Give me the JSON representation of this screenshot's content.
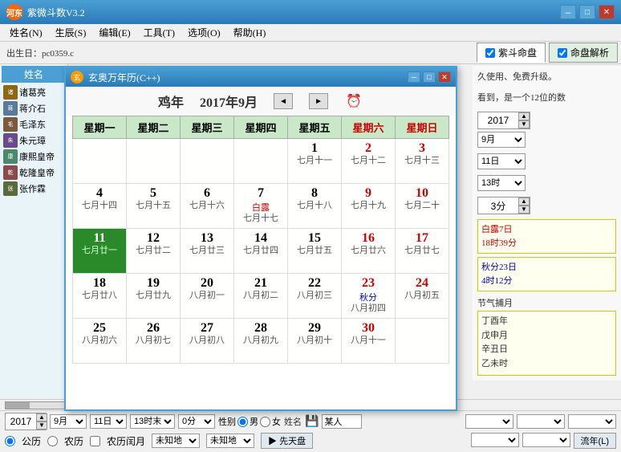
{
  "app": {
    "title": "紫微斗数V3.2",
    "logo": "河东",
    "menu": {
      "items": [
        "姓名(N)",
        "生辰(S)",
        "编辑(E)",
        "工具(T)",
        "选项(O)",
        "帮助(H)"
      ]
    },
    "toolbar": {
      "date_label": "出生日：pc0359,c",
      "tabs": [
        {
          "label": "紫斗命盘",
          "checked": true
        },
        {
          "label": "命盘解析",
          "checked": true
        }
      ]
    }
  },
  "sidebar": {
    "header": "姓名",
    "people": [
      {
        "name": "诸葛亮",
        "has_avatar": true
      },
      {
        "name": "蒋介石",
        "has_avatar": true
      },
      {
        "name": "毛泽东",
        "has_avatar": true
      },
      {
        "name": "朱元璋",
        "has_avatar": true
      },
      {
        "name": "康熙皇帝",
        "has_avatar": true
      },
      {
        "name": "乾隆皇帝",
        "has_avatar": true
      },
      {
        "name": "张作霖",
        "has_avatar": true
      }
    ]
  },
  "calendar": {
    "title": "玄奥万年历(C++)",
    "year_label": "鸡年",
    "month_label": "2017年9月",
    "weekdays": [
      "星期一",
      "星期二",
      "星期三",
      "星期四",
      "星期五",
      "星期六",
      "星期日"
    ],
    "weeks": [
      [
        {
          "day": "",
          "lunar": ""
        },
        {
          "day": "",
          "lunar": ""
        },
        {
          "day": "",
          "lunar": ""
        },
        {
          "day": "",
          "lunar": ""
        },
        {
          "day": "1",
          "lunar": "七月十一",
          "red": false
        },
        {
          "day": "2",
          "lunar": "七月十二",
          "red": true,
          "weekend": true
        },
        {
          "day": "3",
          "lunar": "七月十三",
          "red": true,
          "weekend": true
        }
      ],
      [
        {
          "day": "4",
          "lunar": "七月十四"
        },
        {
          "day": "5",
          "lunar": "七月十五"
        },
        {
          "day": "6",
          "lunar": "七月十六"
        },
        {
          "day": "7",
          "lunar": "七月十七",
          "solar_term": "白露",
          "term_color": "red"
        },
        {
          "day": "8",
          "lunar": "七月十八"
        },
        {
          "day": "9",
          "lunar": "七月十九",
          "weekend": true
        },
        {
          "day": "10",
          "lunar": "七月二十",
          "weekend": true
        }
      ],
      [
        {
          "day": "11",
          "lunar": "七月廿一",
          "today": true
        },
        {
          "day": "12",
          "lunar": "七月廿二"
        },
        {
          "day": "13",
          "lunar": "七月廿三"
        },
        {
          "day": "14",
          "lunar": "七月廿四"
        },
        {
          "day": "15",
          "lunar": "七月廿五"
        },
        {
          "day": "16",
          "lunar": "七月廿六",
          "weekend": true
        },
        {
          "day": "17",
          "lunar": "七月廿七",
          "weekend": true
        }
      ],
      [
        {
          "day": "18",
          "lunar": "七月廿八"
        },
        {
          "day": "19",
          "lunar": "七月廿九"
        },
        {
          "day": "20",
          "lunar": "八月初一"
        },
        {
          "day": "21",
          "lunar": "八月初二"
        },
        {
          "day": "22",
          "lunar": "八月初三"
        },
        {
          "day": "23",
          "lunar": "八月初四",
          "solar_term": "秋分",
          "term_color": "blue",
          "weekend": true
        },
        {
          "day": "24",
          "lunar": "八月初五",
          "weekend": true
        }
      ],
      [
        {
          "day": "25",
          "lunar": "八月初六"
        },
        {
          "day": "26",
          "lunar": "八月初七"
        },
        {
          "day": "27",
          "lunar": "八月初八"
        },
        {
          "day": "28",
          "lunar": "八月初九"
        },
        {
          "day": "29",
          "lunar": "八月初十"
        },
        {
          "day": "30",
          "lunar": "八月十一",
          "weekend": true
        },
        {
          "day": "",
          "lunar": "",
          "weekend": true
        }
      ]
    ]
  },
  "right_panel": {
    "description": "久使用、免费升级。",
    "description2": "看到，是一个12位的数",
    "year": "2017",
    "month": "9月",
    "day": "11日",
    "hour": "13时",
    "minute": "3分",
    "solar_term1": "白露7日",
    "solar_term1_time": "18时39分",
    "solar_term2": "秋分23日",
    "solar_term2_time": "4时12分",
    "jieqi_label": "节气捕月",
    "jieqi_text": "丁酉年\n戊申月\n辛丑日\n乙未时"
  },
  "status_bar": {
    "year_val": "2017",
    "month_val": "9月",
    "day_val": "11日",
    "hour_val": "13时末",
    "minute_val": "0分",
    "gender_male_label": "男",
    "gender_female_label": "女",
    "name_label": "姓名",
    "name_val": "某人",
    "calendar_type": "公历",
    "lunar_type": "农历",
    "run_type": "农历闰月",
    "birth_place1": "未知地",
    "birth_place2": "未知地",
    "btn_xiantian": "先天盘",
    "btn_liuyue": "流年(L)",
    "save_icon": "💾"
  }
}
